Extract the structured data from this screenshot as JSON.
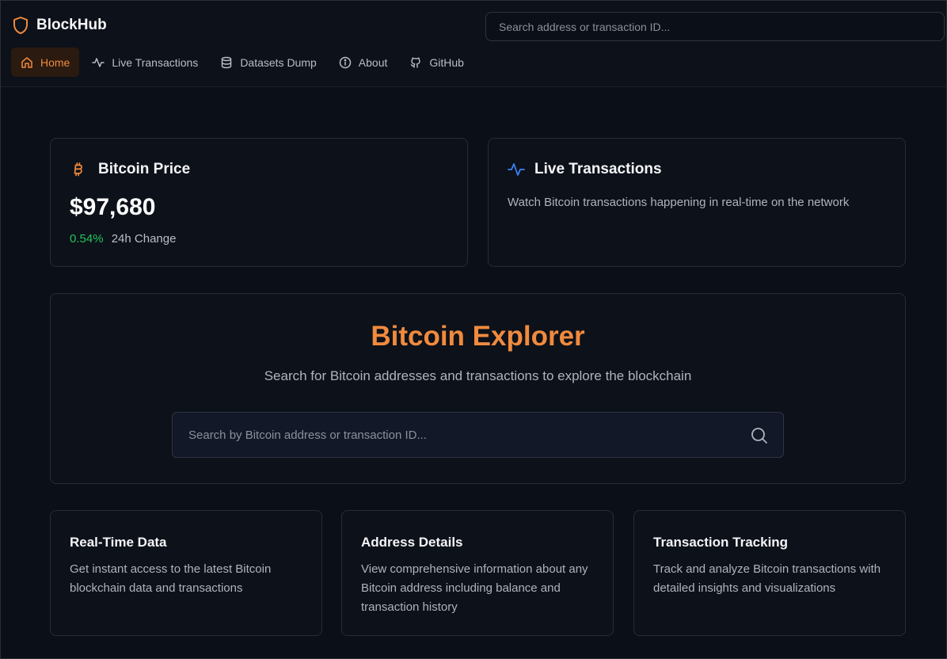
{
  "brand": {
    "name": "BlockHub",
    "accent": "#f08a3e"
  },
  "header": {
    "search_placeholder": "Search address or transaction ID..."
  },
  "nav": [
    {
      "label": "Home",
      "icon": "home-icon",
      "active": true
    },
    {
      "label": "Live Transactions",
      "icon": "activity-icon"
    },
    {
      "label": "Datasets Dump",
      "icon": "database-icon"
    },
    {
      "label": "About",
      "icon": "info-icon"
    },
    {
      "label": "GitHub",
      "icon": "github-icon"
    }
  ],
  "price_card": {
    "title": "Bitcoin Price",
    "icon": "bitcoin-icon",
    "value": "$97,680",
    "change_pct": "0.54%",
    "change_label": "24h Change",
    "change_color": "#22c55e"
  },
  "live_card": {
    "title": "Live Transactions",
    "icon": "activity-icon",
    "icon_color": "#3b82f6",
    "description": "Watch Bitcoin transactions happening in real-time on the network"
  },
  "explorer": {
    "title": "Bitcoin Explorer",
    "subtitle": "Search for Bitcoin addresses and transactions to explore the blockchain",
    "search_placeholder": "Search by Bitcoin address or transaction ID..."
  },
  "features": [
    {
      "title": "Real-Time Data",
      "description": "Get instant access to the latest Bitcoin blockchain data and transactions"
    },
    {
      "title": "Address Details",
      "description": "View comprehensive information about any Bitcoin address including balance and transaction history"
    },
    {
      "title": "Transaction Tracking",
      "description": "Track and analyze Bitcoin transactions with detailed insights and visualizations"
    }
  ]
}
